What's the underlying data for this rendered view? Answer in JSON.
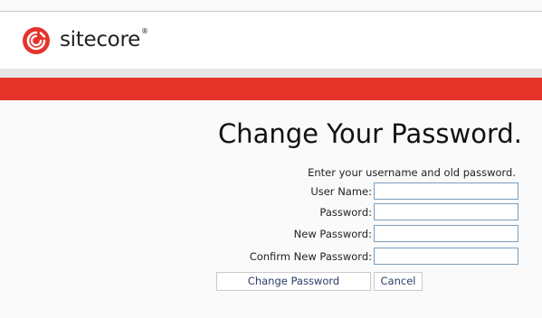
{
  "brand": {
    "name": "sitecore",
    "reg_mark": "®",
    "accent_color": "#e5332a",
    "logo_icon": "sitecore-logo-icon"
  },
  "page": {
    "title": "Change Your Password.",
    "instructions": "Enter your username and old password."
  },
  "form": {
    "fields": [
      {
        "label": "User Name:",
        "value": ""
      },
      {
        "label": "Password:",
        "value": ""
      },
      {
        "label": "New Password:",
        "value": ""
      },
      {
        "label": "Confirm New Password:",
        "value": ""
      }
    ],
    "change_button_label": "Change Password",
    "cancel_button_label": "Cancel"
  }
}
